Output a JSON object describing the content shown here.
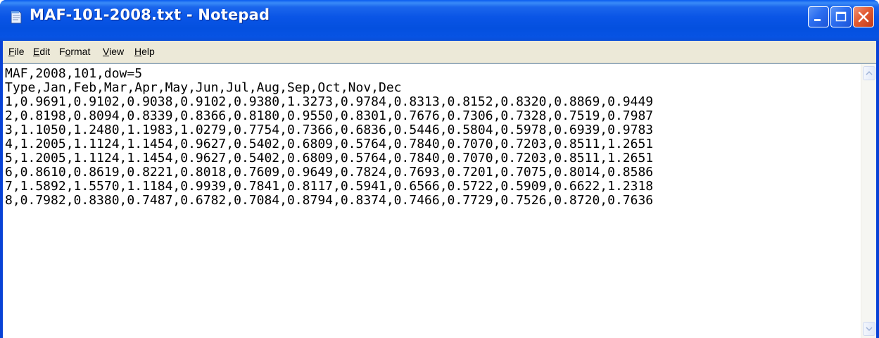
{
  "window": {
    "title": "MAF-101-2008.txt - Notepad",
    "icon": "notepad-icon",
    "titlebar_color": "#0a55e6",
    "close_button_color": "#e35c33"
  },
  "menu": {
    "items": [
      {
        "label": "File",
        "mnemonic": "F"
      },
      {
        "label": "Edit",
        "mnemonic": "E"
      },
      {
        "label": "Format",
        "mnemonic": "o"
      },
      {
        "label": "View",
        "mnemonic": "V"
      },
      {
        "label": "Help",
        "mnemonic": "H"
      }
    ]
  },
  "editor": {
    "lines": [
      "MAF,2008,101,dow=5",
      "Type,Jan,Feb,Mar,Apr,May,Jun,Jul,Aug,Sep,Oct,Nov,Dec",
      "1,0.9691,0.9102,0.9038,0.9102,0.9380,1.3273,0.9784,0.8313,0.8152,0.8320,0.8869,0.9449",
      "2,0.8198,0.8094,0.8339,0.8366,0.8180,0.9550,0.8301,0.7676,0.7306,0.7328,0.7519,0.7987",
      "3,1.1050,1.2480,1.1983,1.0279,0.7754,0.7366,0.6836,0.5446,0.5804,0.5978,0.6939,0.9783",
      "4,1.2005,1.1124,1.1454,0.9627,0.5402,0.6809,0.5764,0.7840,0.7070,0.7203,0.8511,1.2651",
      "5,1.2005,1.1124,1.1454,0.9627,0.5402,0.6809,0.5764,0.7840,0.7070,0.7203,0.8511,1.2651",
      "6,0.8610,0.8619,0.8221,0.8018,0.7609,0.9649,0.7824,0.7693,0.7201,0.7075,0.8014,0.8586",
      "7,1.5892,1.5570,1.1184,0.9939,0.7841,0.8117,0.5941,0.6566,0.5722,0.5909,0.6622,1.2318",
      "8,0.7982,0.8380,0.7487,0.6782,0.7084,0.8794,0.8374,0.7466,0.7729,0.7526,0.8720,0.7636"
    ]
  },
  "scrollbar": {
    "up_icon": "scroll-up-arrow-icon",
    "down_icon": "scroll-down-arrow-icon"
  }
}
